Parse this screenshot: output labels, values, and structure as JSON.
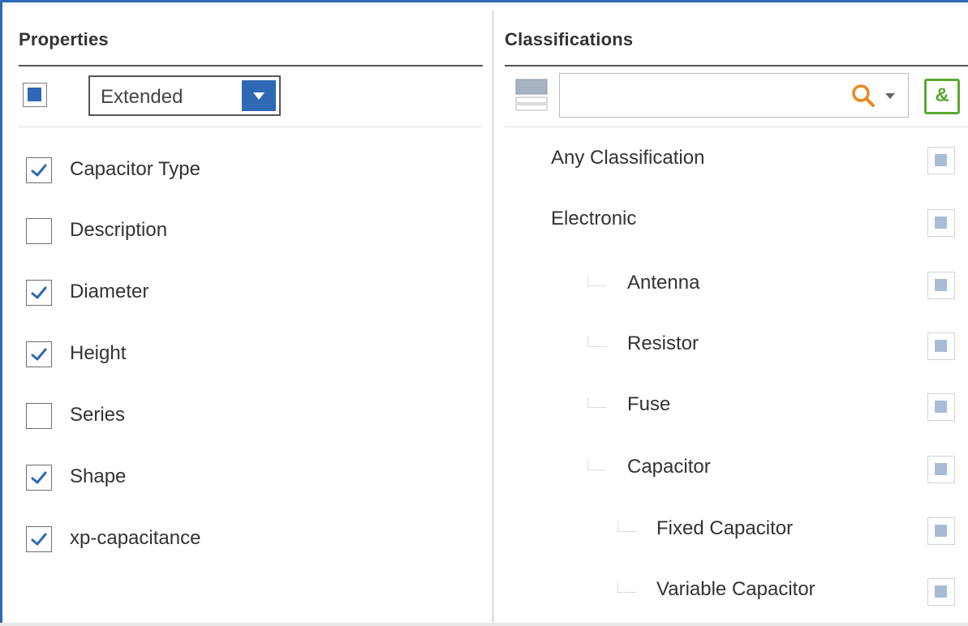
{
  "properties": {
    "title": "Properties",
    "filter_value": "Extended",
    "items": [
      {
        "label": "Capacitor Type",
        "checked": true
      },
      {
        "label": "Description",
        "checked": false
      },
      {
        "label": "Diameter",
        "checked": true
      },
      {
        "label": "Height",
        "checked": true
      },
      {
        "label": "Series",
        "checked": false
      },
      {
        "label": "Shape",
        "checked": true
      },
      {
        "label": "xp-capacitance",
        "checked": true
      }
    ]
  },
  "classifications": {
    "title": "Classifications",
    "search_value": "",
    "and_button_label": "&",
    "items": [
      {
        "label": "Any Classification",
        "level": 0
      },
      {
        "label": "Electronic",
        "level": 0
      },
      {
        "label": "Antenna",
        "level": 1
      },
      {
        "label": "Resistor",
        "level": 1
      },
      {
        "label": "Fuse",
        "level": 1
      },
      {
        "label": "Capacitor",
        "level": 1
      },
      {
        "label": "Fixed Capacitor",
        "level": 2
      },
      {
        "label": "Variable Capacitor",
        "level": 2
      }
    ]
  },
  "colors": {
    "accent": "#2f68b5",
    "and_button": "#5aa832",
    "search_icon": "#e8891d"
  },
  "icons": {
    "view_toggle": "list-view-icon",
    "search": "search-icon",
    "search_dropdown": "chevron-down-icon",
    "checkmark": "check-icon"
  }
}
